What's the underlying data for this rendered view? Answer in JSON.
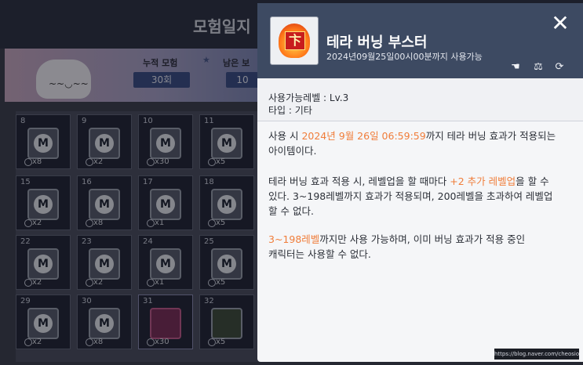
{
  "background": {
    "title": "모험일지",
    "stat_left_label": "누적 모험",
    "stat_left_value": "30회",
    "stat_right_label": "남은 보",
    "stat_right_value": "10",
    "mascot_face": "~~◡~~",
    "slots": [
      {
        "num": "8",
        "qty": "x8",
        "kind": "m"
      },
      {
        "num": "9",
        "qty": "x2",
        "kind": "m"
      },
      {
        "num": "10",
        "qty": "x30",
        "kind": "m"
      },
      {
        "num": "11",
        "qty": "x5",
        "kind": "m"
      },
      {
        "num": "15",
        "qty": "x2",
        "kind": "m"
      },
      {
        "num": "16",
        "qty": "x8",
        "kind": "m"
      },
      {
        "num": "17",
        "qty": "x1",
        "kind": "m"
      },
      {
        "num": "18",
        "qty": "x5",
        "kind": "m"
      },
      {
        "num": "22",
        "qty": "x2",
        "kind": "m"
      },
      {
        "num": "23",
        "qty": "x2",
        "kind": "m"
      },
      {
        "num": "24",
        "qty": "x1",
        "kind": "m"
      },
      {
        "num": "25",
        "qty": "x5",
        "kind": "m"
      },
      {
        "num": "29",
        "qty": "x2",
        "kind": "m"
      },
      {
        "num": "30",
        "qty": "x8",
        "kind": "m"
      },
      {
        "num": "31",
        "qty": "x30",
        "kind": "special"
      },
      {
        "num": "32",
        "qty": "x5",
        "kind": "special2"
      }
    ]
  },
  "popup": {
    "item_name": "테라 버닝 부스터",
    "expire_text": "2024년09월25일00시00분까지 사용가능",
    "icon_glyph": "卞",
    "close_label": "✕",
    "header_icons": [
      "trade-hand-icon",
      "scale-icon",
      "recycle-icon"
    ],
    "meta": {
      "level": "사용가능레벨 : Lv.3",
      "type": "타입 : 기타"
    },
    "desc": {
      "p1_a": "사용 시 ",
      "p1_hl": "2024년 9월 26일 06:59:59",
      "p1_b": "까지 테라 버닝 효과가 적용되는",
      "p1_c": "아이템이다.",
      "p2_a": "테라 버닝 효과 적용 시, 레벨업을 할 때마다 ",
      "p2_hl": "+2 추가 레벨업",
      "p2_b": "을 할 수",
      "p2_c": "있다. 3~198레벨까지 효과가 적용되며, 200레벨을 초과하여 레벨업",
      "p2_d": "할 수 없다.",
      "p3_hl": "3~198레벨",
      "p3_a": "까지만 사용 가능하며, 이미 버닝 효과가 적용 중인",
      "p3_b": "캐릭터는 사용할 수 없다."
    },
    "colors": {
      "highlight": "#f07d3a",
      "header": "#3d4a62"
    }
  },
  "watermark": "https://blog.naver.com/cheosio"
}
